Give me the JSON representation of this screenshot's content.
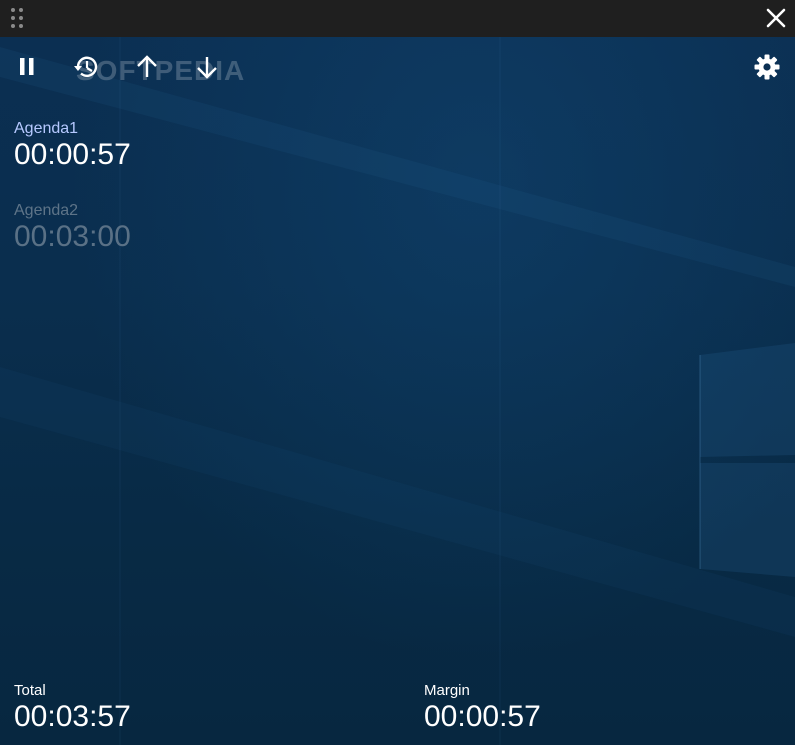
{
  "icons": {
    "drag": "drag-handle-icon",
    "close": "close-icon",
    "pause": "pause-icon",
    "history": "history-icon",
    "up": "arrow-up-icon",
    "down": "arrow-down-icon",
    "settings": "gear-icon"
  },
  "watermark": "SOFTPEDIA",
  "agendas": [
    {
      "name": "Agenda1",
      "time": "00:00:57",
      "state": "active"
    },
    {
      "name": "Agenda2",
      "time": "00:03:00",
      "state": "inactive"
    }
  ],
  "footer": {
    "total_label": "Total",
    "total_value": "00:03:57",
    "margin_label": "Margin",
    "margin_value": "00:00:57"
  },
  "colors": {
    "titlebar": "#1f1f1f",
    "background": "#0a2e4e",
    "active_name": "#b6c9ff",
    "inactive_text": "#5e7488",
    "text": "#ffffff"
  }
}
